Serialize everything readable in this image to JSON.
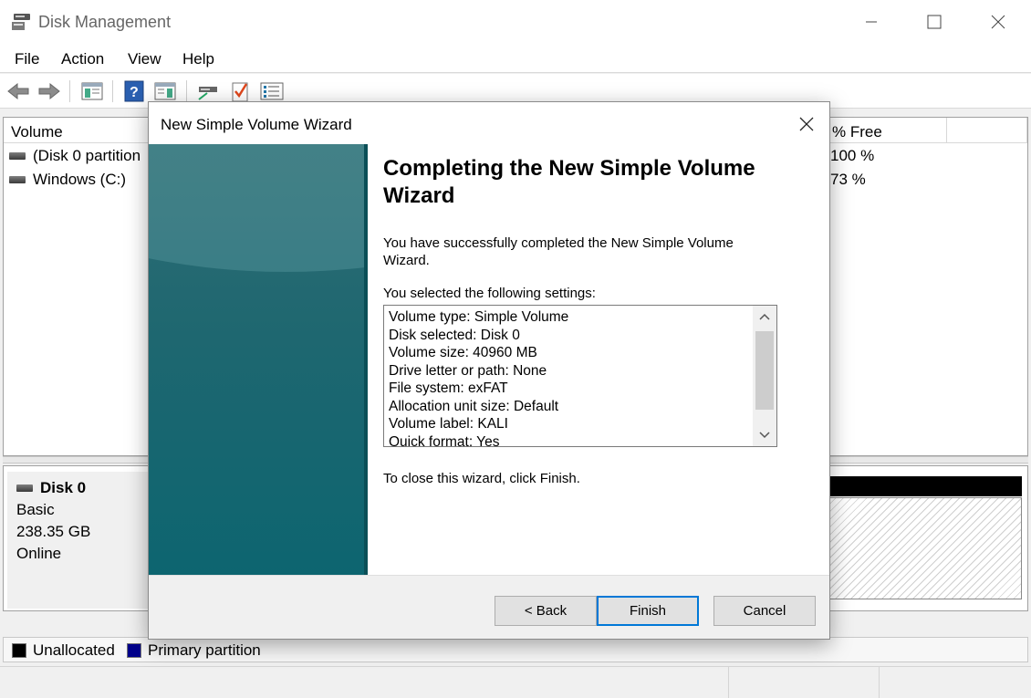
{
  "window": {
    "title": "Disk Management"
  },
  "menu": [
    "File",
    "Action",
    "View",
    "Help"
  ],
  "volume_list": {
    "columns": [
      "Volume",
      "% Free"
    ],
    "rows": [
      {
        "volume": "(Disk 0 partition",
        "free": "100 %"
      },
      {
        "volume": "Windows (C:)",
        "free": "73 %"
      }
    ]
  },
  "disk": {
    "name": "Disk 0",
    "type": "Basic",
    "size": "238.35 GB",
    "status": "Online"
  },
  "legend": [
    {
      "label": "Unallocated",
      "color": "#000000"
    },
    {
      "label": "Primary partition",
      "color": "#00008b"
    }
  ],
  "wizard": {
    "title": "New Simple Volume Wizard",
    "heading": "Completing the New Simple Volume Wizard",
    "intro": "You have successfully completed the New Simple Volume Wizard.",
    "settings_label": "You selected the following settings:",
    "settings": [
      "Volume type: Simple Volume",
      "Disk selected: Disk 0",
      "Volume size: 40960 MB",
      "Drive letter or path: None",
      "File system: exFAT",
      "Allocation unit size: Default",
      "Volume label: KALI",
      "Quick format: Yes"
    ],
    "close_hint": "To close this wizard, click Finish.",
    "buttons": {
      "back": "< Back",
      "finish": "Finish",
      "cancel": "Cancel"
    }
  },
  "icons": [
    "disk-management-icon",
    "back-arrow-icon",
    "forward-arrow-icon",
    "console-tree-icon",
    "help-icon",
    "action-pane-icon",
    "connect-icon",
    "check-icon",
    "properties-icon",
    "close-icon",
    "minimize-icon",
    "maximize-icon",
    "scroll-up-icon",
    "scroll-down-icon"
  ]
}
